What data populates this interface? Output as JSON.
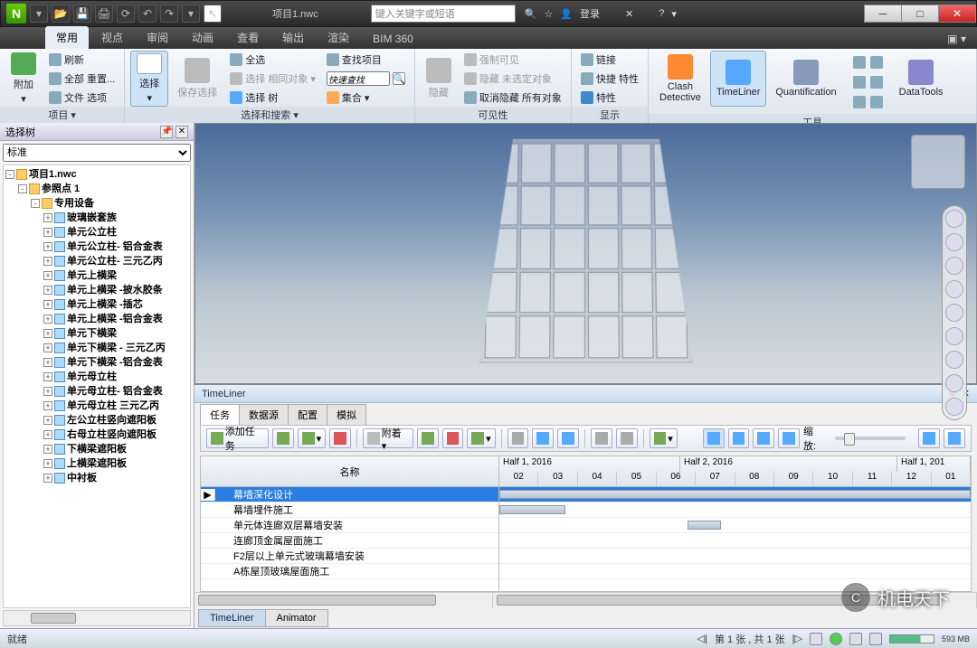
{
  "titlebar": {
    "logo": "N",
    "filename": "项目1.nwc",
    "search_placeholder": "键入关键字或短语",
    "login": "登录"
  },
  "winbuttons": {
    "min": "─",
    "max": "□",
    "close": "✕"
  },
  "tabs": [
    "常用",
    "视点",
    "审阅",
    "动画",
    "查看",
    "输出",
    "渲染",
    "BIM 360"
  ],
  "active_tab": 0,
  "ribbon": {
    "p1": {
      "title": "项目 ▾",
      "append": "附加",
      "refresh": "刷新",
      "resetall": "全部 重置...",
      "fileopts": "文件 选项"
    },
    "p2": {
      "title": "选择和搜索 ▾",
      "select": "选择",
      "save": "保存选择",
      "selall": "全选",
      "selsame": "选择 相同对象 ▾",
      "seltree": "选择 树",
      "findproj": "查找项目",
      "quickfind": "快速查找",
      "sets": "集合 ▾"
    },
    "p3": {
      "title": "可见性",
      "reqhide": "强制可见",
      "hideunsel": "隐藏 未选定对象",
      "unhideall": "取消隐藏 所有对象"
    },
    "p4": {
      "title": "显示",
      "links": "链接",
      "quickprops": "快捷 特性",
      "props": "特性"
    },
    "p5": {
      "title": "工具",
      "clash": "Clash\nDetective",
      "tl": "TimeLiner",
      "quant": "Quantification",
      "dt": "DataTools"
    }
  },
  "left_panel": {
    "title": "选择树",
    "dropdown": "标准",
    "root": "项目1.nwc",
    "level1": "参照点 1",
    "level2": "专用设备",
    "items": [
      "玻璃嵌套族",
      "单元公立柱",
      "单元公立柱- 铝合金表",
      "单元公立柱- 三元乙丙",
      "单元上横梁",
      "单元上横梁 -披水胶条",
      "单元上横梁 -插芯",
      "单元上横梁 -铝合金表",
      "单元下横梁",
      "单元下横梁 - 三元乙丙",
      "单元下横梁 -铝合金表",
      "单元母立柱",
      "单元母立柱- 铝合金表",
      "单元母立柱 三元乙丙",
      "左公立柱竖向遮阳板",
      "右母立柱竖向遮阳板",
      "下横梁遮阳板",
      "上横梁遮阳板",
      "中衬板"
    ]
  },
  "timeliner": {
    "title": "TimeLiner",
    "tabs": [
      "任务",
      "数据源",
      "配置",
      "模拟"
    ],
    "active_tab": 0,
    "btn_addtask": "添加任务",
    "btn_attach": "附着 ▾",
    "label_zoom": "缩放:",
    "name_col": "名称",
    "halves": [
      "Half 1, 2016",
      "Half 2, 2016",
      "Half 1, 201"
    ],
    "months": [
      "02",
      "03",
      "04",
      "05",
      "06",
      "07",
      "08",
      "09",
      "10",
      "11",
      "12",
      "01"
    ],
    "tasks": [
      {
        "name": "幕墙深化设计",
        "sel": true,
        "bar": [
          0,
          100
        ]
      },
      {
        "name": "幕墙埋件施工",
        "bar": [
          0,
          14
        ]
      },
      {
        "name": "单元体连廊双层幕墙安装",
        "bar": [
          40,
          47
        ]
      },
      {
        "name": "连廊顶金属屋面施工"
      },
      {
        "name": "F2层以上单元式玻璃幕墙安装"
      },
      {
        "name": "A栋屋顶玻璃屋面施工"
      }
    ],
    "bottom_tabs": [
      "TimeLiner",
      "Animator"
    ]
  },
  "status": {
    "ready": "就绪",
    "pager": "第 1 张 , 共 1 张",
    "mem": "593 MB"
  },
  "watermark": "机电天下"
}
